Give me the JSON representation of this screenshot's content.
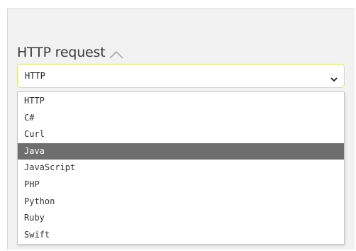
{
  "section": {
    "title": "HTTP request",
    "collapse_icon": "chevron-up-icon"
  },
  "select": {
    "value": "HTTP",
    "icon": "chevron-down-icon",
    "accent_border_color": "#d8e86a"
  },
  "dropdown": {
    "highlighted_index": 3,
    "highlight_color": "#6e6e6e",
    "options": [
      {
        "label": "HTTP"
      },
      {
        "label": "C#"
      },
      {
        "label": "Curl"
      },
      {
        "label": "Java"
      },
      {
        "label": "JavaScript"
      },
      {
        "label": "PHP"
      },
      {
        "label": "Python"
      },
      {
        "label": "Ruby"
      },
      {
        "label": "Swift"
      }
    ]
  }
}
